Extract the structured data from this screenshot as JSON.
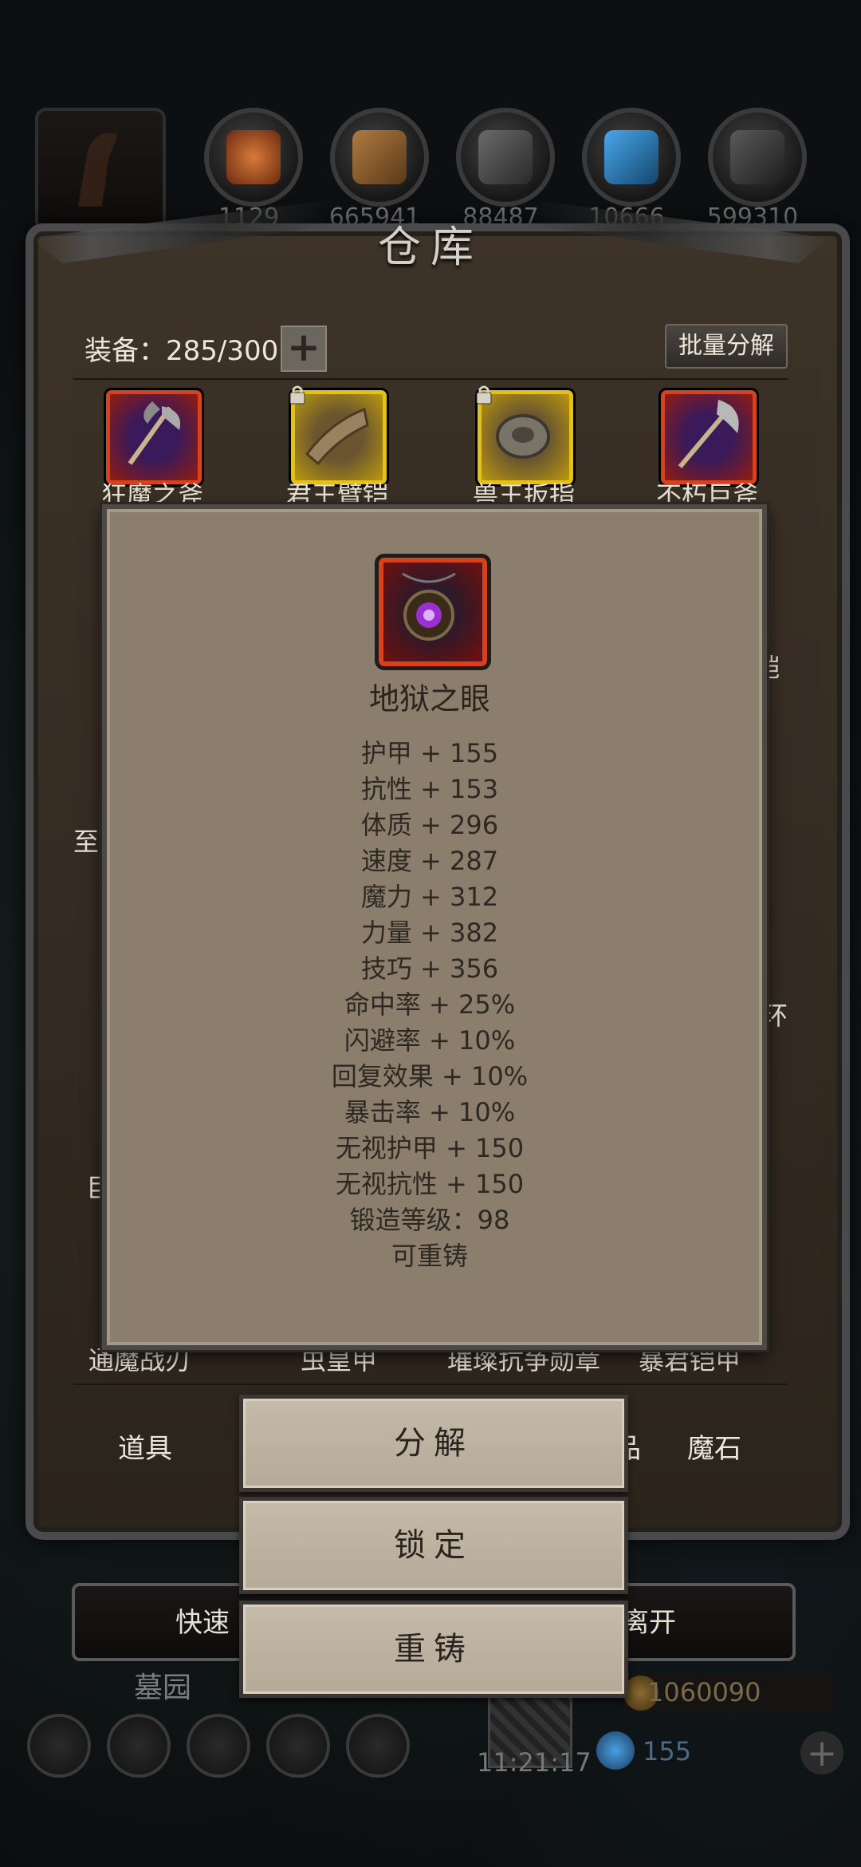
{
  "warehouse": {
    "title": "仓库",
    "equipment_count_label": "装备：285/300",
    "plus_symbol": "+",
    "batch_disassemble_label": "批量分解"
  },
  "resources": [
    {
      "icon": "gourd-icon",
      "value": "1129",
      "color": "#b65a2a"
    },
    {
      "icon": "wood-planks-icon",
      "value": "665941",
      "color": "#9a6a3a"
    },
    {
      "icon": "iron-ingot-icon",
      "value": "88487",
      "color": "#5a5a5a"
    },
    {
      "icon": "crystal-icon",
      "value": "10666",
      "color": "#2d7fc0"
    },
    {
      "icon": "stone-icon",
      "value": "599310",
      "color": "#4a4a4a"
    }
  ],
  "items_top": [
    {
      "name": "狂魔之斧",
      "icon": "axe-icon",
      "locked": false
    },
    {
      "name": "君王臂铠",
      "icon": "bracer-icon",
      "locked": true
    },
    {
      "name": "兽王扳指",
      "icon": "ring-icon",
      "locked": true
    },
    {
      "name": "不朽巨斧",
      "icon": "battle-axe-icon",
      "locked": false
    }
  ],
  "items_peek": {
    "left_1": "至高",
    "left_2": "巨",
    "right_1": "铠",
    "right_2": "指环"
  },
  "items_bottom": [
    {
      "name": "通魔战刃"
    },
    {
      "name": "虫皇甲"
    },
    {
      "name": "璀璨抗争勋章"
    },
    {
      "name": "暴君铠甲"
    }
  ],
  "tabs": {
    "left": "道具",
    "right": "魔石",
    "hidden_fragment": "品"
  },
  "popup": {
    "item_icon": "amulet-icon",
    "item_name": "地狱之眼",
    "stats": [
      "护甲 + 155",
      "抗性 + 153",
      "体质 + 296",
      "速度 + 287",
      "魔力 + 312",
      "力量 + 382",
      "技巧 + 356",
      "命中率 + 25%",
      "闪避率 + 10%",
      "回复效果 + 10%",
      "暴击率 + 10%",
      "无视护甲 + 150",
      "无视抗性 + 150",
      "锻造等级：98",
      "可重铸"
    ]
  },
  "actions": {
    "disassemble": "分解",
    "lock": "锁定",
    "reforge": "重铸"
  },
  "footer": {
    "quick_left": "快速",
    "quick_right": "离开",
    "location": "墓园",
    "clock": "11:21:17",
    "gold": "1060090",
    "gems": "155",
    "add_symbol": "+"
  }
}
